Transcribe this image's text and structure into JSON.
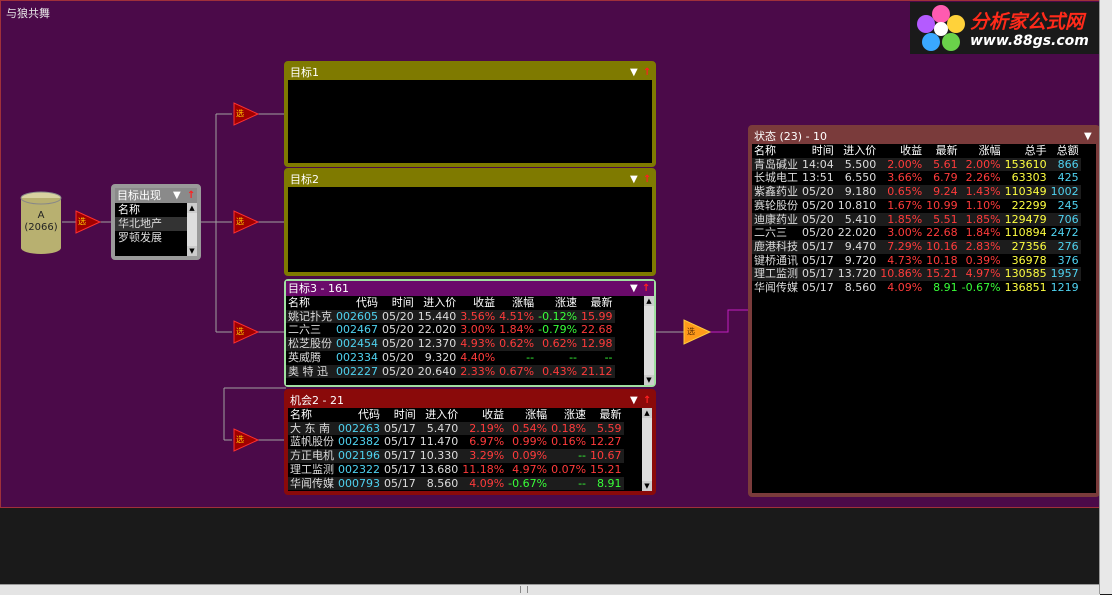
{
  "window_title": "与狼共舞",
  "logo": {
    "line1": "分析家公式网",
    "line2": "www.88gs.com"
  },
  "source_node": {
    "label": "A",
    "count": "(2066)"
  },
  "filter_icon_label": "选",
  "target_panel": {
    "title": "目标出现",
    "header": "名称",
    "items": [
      "华北地产",
      "罗顿发展"
    ]
  },
  "target1": {
    "title": "目标1"
  },
  "target2": {
    "title": "目标2"
  },
  "target3": {
    "title": "目标3 - 161",
    "headers": [
      "名称",
      "代码",
      "时间",
      "进入价",
      "收益",
      "涨幅",
      "涨速",
      "最新"
    ],
    "rows": [
      {
        "name": "姚记扑克",
        "code": "002605",
        "time": "05/20",
        "price": "15.440",
        "gain": "3.56%",
        "chg": "4.51%",
        "speed": "-0.12%",
        "last": "15.99"
      },
      {
        "name": "二六三",
        "code": "002467",
        "time": "05/20",
        "price": "22.020",
        "gain": "3.00%",
        "chg": "1.84%",
        "speed": "-0.79%",
        "last": "22.68"
      },
      {
        "name": "松芝股份",
        "code": "002454",
        "time": "05/20",
        "price": "12.370",
        "gain": "4.93%",
        "chg": "0.62%",
        "speed": "0.62%",
        "last": "12.98"
      },
      {
        "name": "英威腾",
        "code": "002334",
        "time": "05/20",
        "price": "9.320",
        "gain": "4.40%",
        "chg": "--",
        "speed": "--",
        "last": "--"
      },
      {
        "name": "奥 特 迅",
        "code": "002227",
        "time": "05/20",
        "price": "20.640",
        "gain": "2.33%",
        "chg": "0.67%",
        "speed": "0.43%",
        "last": "21.12"
      }
    ]
  },
  "chance2": {
    "title": "机会2 - 21",
    "headers": [
      "名称",
      "代码",
      "时间",
      "进入价",
      "收益",
      "涨幅",
      "涨速",
      "最新"
    ],
    "rows": [
      {
        "name": "大 东 南",
        "code": "002263",
        "time": "05/17",
        "price": "5.470",
        "gain": "2.19%",
        "chg": "0.54%",
        "speed": "0.18%",
        "last": "5.59"
      },
      {
        "name": "蓝帆股份",
        "code": "002382",
        "time": "05/17",
        "price": "11.470",
        "gain": "6.97%",
        "chg": "0.99%",
        "speed": "0.16%",
        "last": "12.27"
      },
      {
        "name": "方正电机",
        "code": "002196",
        "time": "05/17",
        "price": "10.330",
        "gain": "3.29%",
        "chg": "0.09%",
        "speed": "--",
        "last": "10.67"
      },
      {
        "name": "理工监测",
        "code": "002322",
        "time": "05/17",
        "price": "13.680",
        "gain": "11.18%",
        "chg": "4.97%",
        "speed": "0.07%",
        "last": "15.21"
      },
      {
        "name": "华闻传媒",
        "code": "000793",
        "time": "05/17",
        "price": "8.560",
        "gain": "4.09%",
        "chg": "-0.67%",
        "speed": "--",
        "last": "8.91"
      }
    ]
  },
  "status": {
    "title": "状态 (23) - 10",
    "headers": [
      "名称",
      "时间",
      "进入价",
      "收益",
      "最新",
      "涨幅",
      "总手",
      "总额"
    ],
    "rows": [
      {
        "name": "青岛碱业",
        "time": "14:04",
        "price": "5.500",
        "gain": "2.00%",
        "last": "5.61",
        "chg": "2.00%",
        "vol": "153610",
        "amt": "866"
      },
      {
        "name": "长城电工",
        "time": "13:51",
        "price": "6.550",
        "gain": "3.66%",
        "last": "6.79",
        "chg": "2.26%",
        "vol": "63303",
        "amt": "425"
      },
      {
        "name": "紫鑫药业",
        "time": "05/20",
        "price": "9.180",
        "gain": "0.65%",
        "last": "9.24",
        "chg": "1.43%",
        "vol": "110349",
        "amt": "1002"
      },
      {
        "name": "赛轮股份",
        "time": "05/20",
        "price": "10.810",
        "gain": "1.67%",
        "last": "10.99",
        "chg": "1.10%",
        "vol": "22299",
        "amt": "245"
      },
      {
        "name": "迪康药业",
        "time": "05/20",
        "price": "5.410",
        "gain": "1.85%",
        "last": "5.51",
        "chg": "1.85%",
        "vol": "129479",
        "amt": "706"
      },
      {
        "name": "二六三",
        "time": "05/20",
        "price": "22.020",
        "gain": "3.00%",
        "last": "22.68",
        "chg": "1.84%",
        "vol": "110894",
        "amt": "2472"
      },
      {
        "name": "鹿港科技",
        "time": "05/17",
        "price": "9.470",
        "gain": "7.29%",
        "last": "10.16",
        "chg": "2.83%",
        "vol": "27356",
        "amt": "276"
      },
      {
        "name": "键桥通讯",
        "time": "05/17",
        "price": "9.720",
        "gain": "4.73%",
        "last": "10.18",
        "chg": "0.39%",
        "vol": "36978",
        "amt": "376"
      },
      {
        "name": "理工监测",
        "time": "05/17",
        "price": "13.720",
        "gain": "10.86%",
        "last": "15.21",
        "chg": "4.97%",
        "vol": "130585",
        "amt": "1957"
      },
      {
        "name": "华闻传媒",
        "time": "05/17",
        "price": "8.560",
        "gain": "4.09%",
        "last": "8.91",
        "chg": "-0.67%",
        "vol": "136851",
        "amt": "1219"
      }
    ]
  },
  "colors": {
    "canvas": "#4b0a49",
    "olive": "#7f7a00",
    "purple_head": "#6a0a6a",
    "red_head": "#8a0a0a",
    "status_head": "#7a3b3b"
  }
}
